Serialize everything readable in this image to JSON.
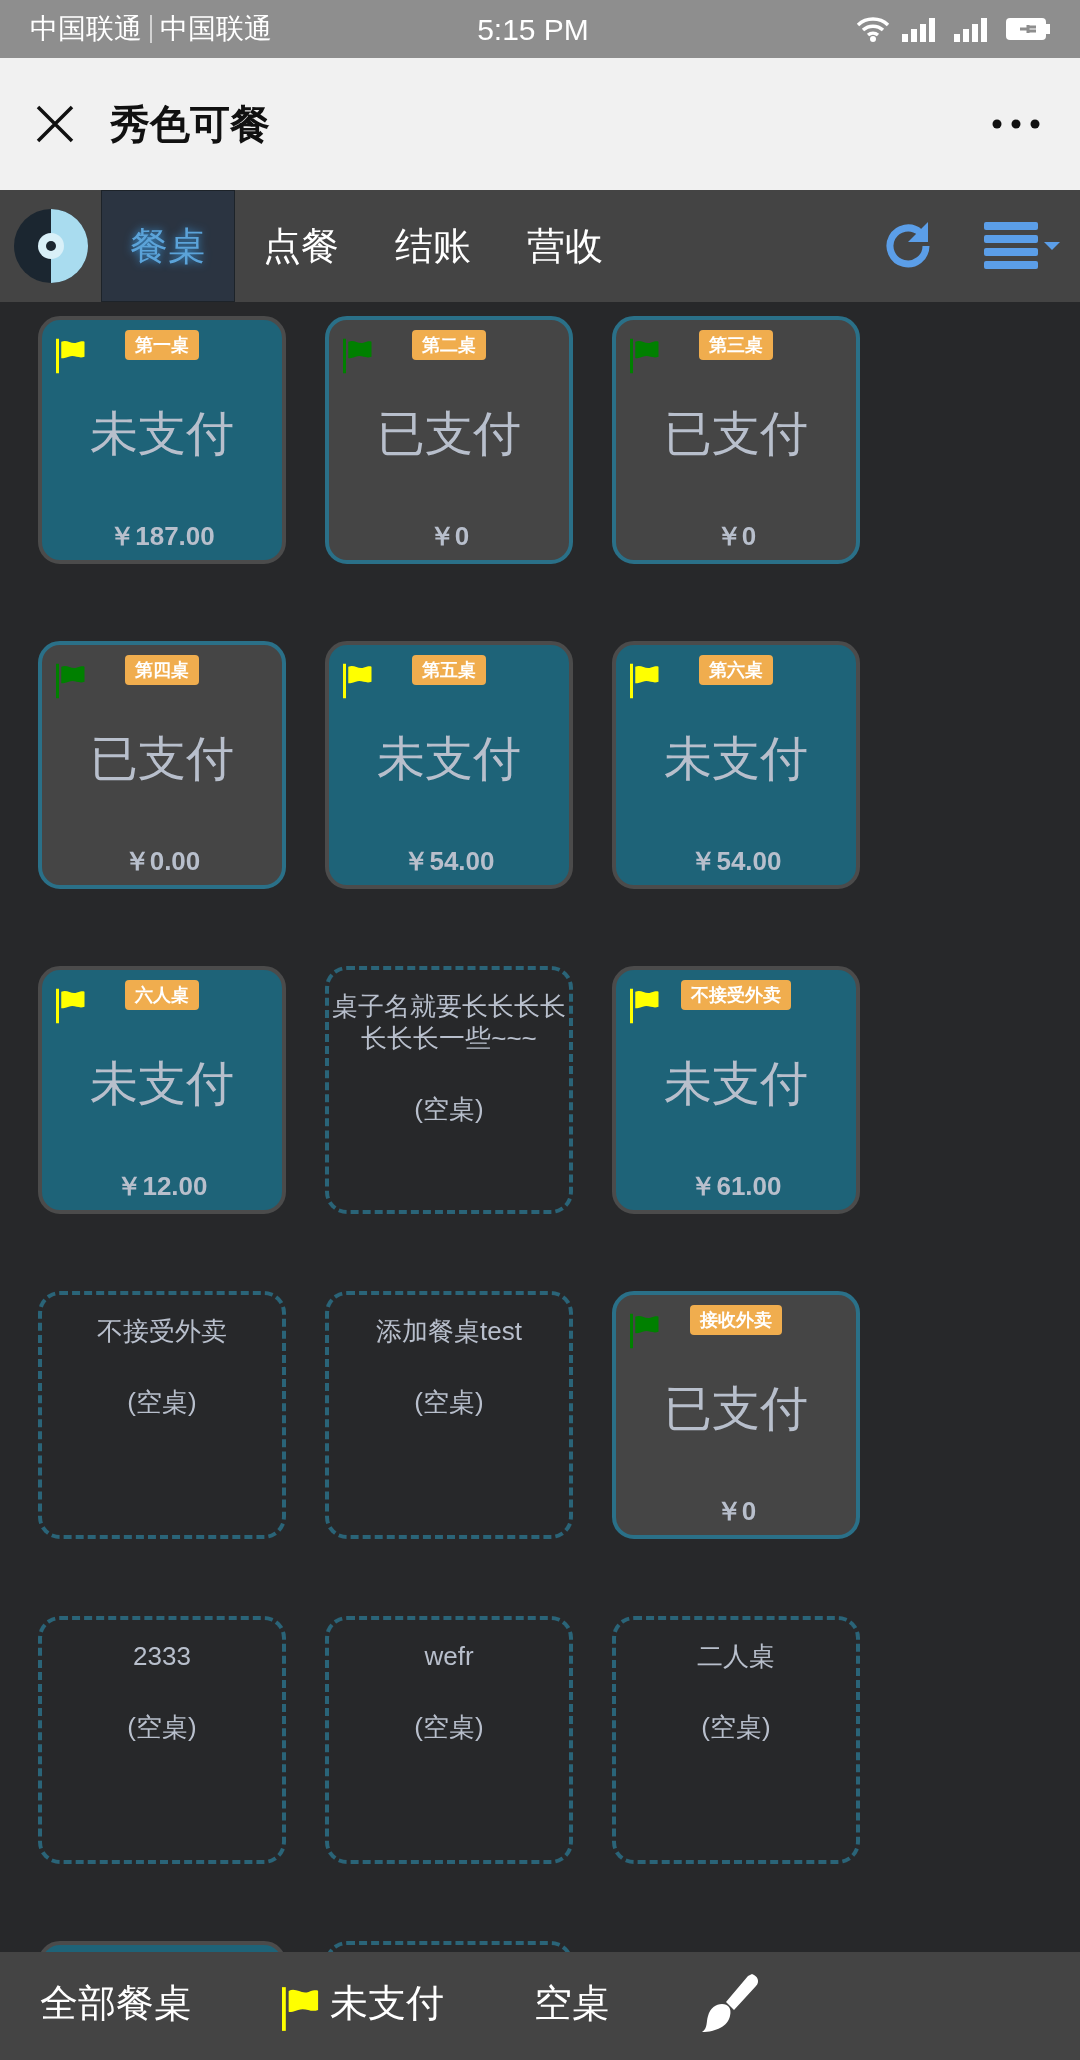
{
  "status_bar": {
    "carriers": [
      "中国联通",
      "中国联通"
    ],
    "time": "5:15 PM"
  },
  "header": {
    "title": "秀色可餐"
  },
  "nav": {
    "tabs": [
      {
        "label": "餐桌",
        "selected": true
      },
      {
        "label": "点餐",
        "selected": false
      },
      {
        "label": "结账",
        "selected": false
      },
      {
        "label": "营收",
        "selected": false
      }
    ]
  },
  "tables": [
    {
      "kind": "occupied",
      "name": "第一桌",
      "status": "未支付",
      "amount": "￥187.00",
      "paid": false,
      "color": "#ffff00"
    },
    {
      "kind": "occupied",
      "name": "第二桌",
      "status": "已支付",
      "amount": "￥0",
      "paid": true,
      "color": "#008000"
    },
    {
      "kind": "occupied",
      "name": "第三桌",
      "status": "已支付",
      "amount": "￥0",
      "paid": true,
      "color": "#008000"
    },
    {
      "kind": "occupied",
      "name": "第四桌",
      "status": "已支付",
      "amount": "￥0.00",
      "paid": true,
      "color": "#008000"
    },
    {
      "kind": "occupied",
      "name": "第五桌",
      "status": "未支付",
      "amount": "￥54.00",
      "paid": false,
      "color": "#ffff00"
    },
    {
      "kind": "occupied",
      "name": "第六桌",
      "status": "未支付",
      "amount": "￥54.00",
      "paid": false,
      "color": "#ffff00"
    },
    {
      "kind": "occupied",
      "name": "六人桌",
      "status": "未支付",
      "amount": "￥12.00",
      "paid": false,
      "color": "#ffff00"
    },
    {
      "kind": "empty",
      "name": "桌子名就要长长长长长长长一些~~~",
      "status": "(空桌)"
    },
    {
      "kind": "occupied",
      "name": "不接受外卖",
      "status": "未支付",
      "amount": "￥61.00",
      "paid": false,
      "color": "#ffff00"
    },
    {
      "kind": "empty",
      "name": "不接受外卖",
      "status": "(空桌)"
    },
    {
      "kind": "empty",
      "name": "添加餐桌test",
      "status": "(空桌)"
    },
    {
      "kind": "occupied",
      "name": "接收外卖",
      "status": "已支付",
      "amount": "￥0",
      "paid": true,
      "color": "#008000"
    },
    {
      "kind": "empty",
      "name": "2333",
      "status": "(空桌)"
    },
    {
      "kind": "empty",
      "name": "wefr",
      "status": "(空桌)"
    },
    {
      "kind": "empty",
      "name": "二人桌",
      "status": "(空桌)"
    },
    {
      "kind": "occupied",
      "paid": false
    },
    {
      "kind": "empty"
    }
  ],
  "filters": [
    {
      "kind": "text",
      "label": "全部餐桌"
    },
    {
      "kind": "flag",
      "label": "未支付",
      "color": "#ffff00"
    },
    {
      "kind": "text",
      "label": "空桌"
    },
    {
      "kind": "brush"
    }
  ]
}
